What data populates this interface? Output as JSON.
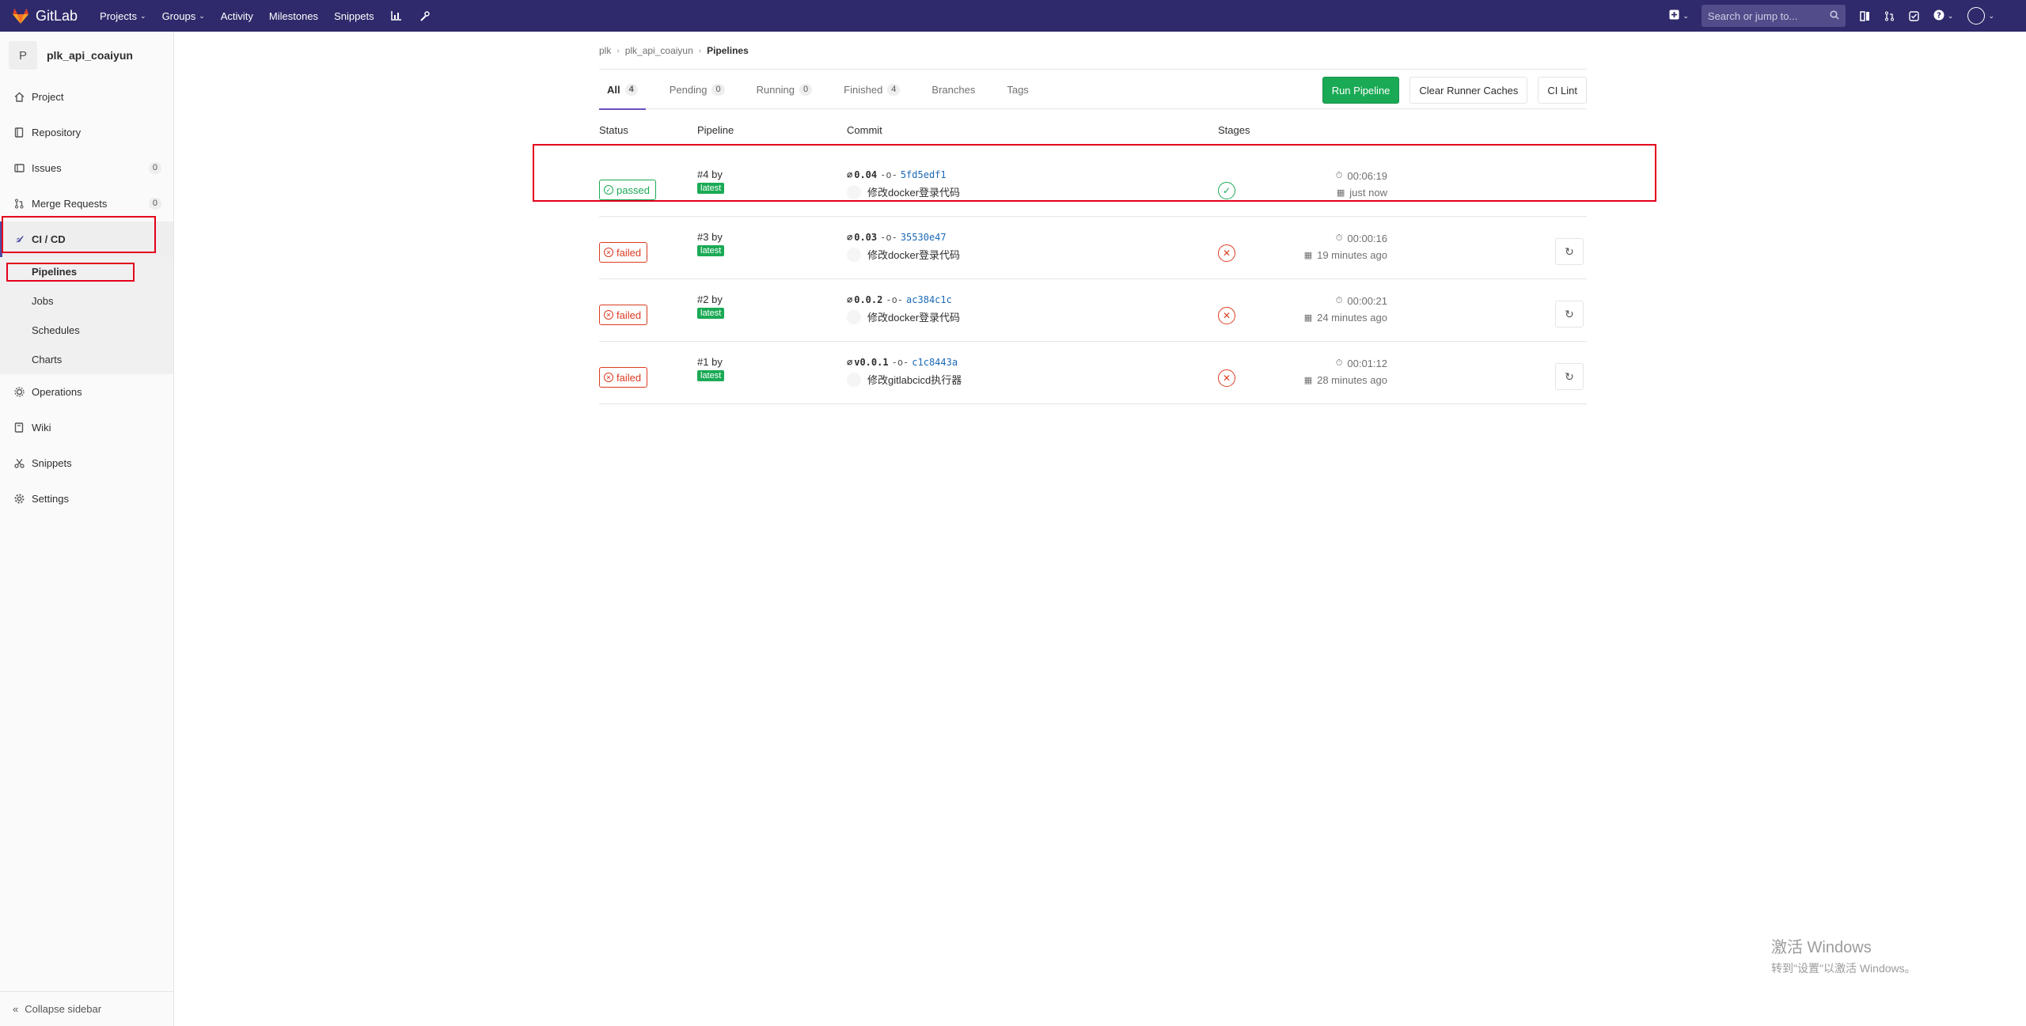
{
  "navbar": {
    "brand": "GitLab",
    "links": [
      {
        "label": "Projects",
        "dropdown": true
      },
      {
        "label": "Groups",
        "dropdown": true
      },
      {
        "label": "Activity",
        "dropdown": false
      },
      {
        "label": "Milestones",
        "dropdown": false
      },
      {
        "label": "Snippets",
        "dropdown": false
      }
    ],
    "search_placeholder": "Search or jump to...",
    "color": "#2f2a6b"
  },
  "sidebar": {
    "project_avatar_letter": "P",
    "project_name": "plk_api_coaiyun",
    "items": [
      {
        "label": "Project",
        "icon": "home-icon"
      },
      {
        "label": "Repository",
        "icon": "book-icon"
      },
      {
        "label": "Issues",
        "icon": "issues-icon",
        "count": "0"
      },
      {
        "label": "Merge Requests",
        "icon": "merge-request-icon",
        "count": "0"
      },
      {
        "label": "CI / CD",
        "icon": "rocket-icon"
      }
    ],
    "sub_items": [
      "Pipelines",
      "Jobs",
      "Schedules",
      "Charts"
    ],
    "items_after": [
      {
        "label": "Operations",
        "icon": "cloud-gear-icon"
      },
      {
        "label": "Wiki",
        "icon": "wiki-book-icon"
      },
      {
        "label": "Snippets",
        "icon": "scissors-icon"
      },
      {
        "label": "Settings",
        "icon": "gear-icon"
      }
    ],
    "collapse_label": "Collapse sidebar"
  },
  "breadcrumb": [
    "plk",
    "plk_api_coaiyun",
    "Pipelines"
  ],
  "tabs": [
    {
      "label": "All",
      "count": "4"
    },
    {
      "label": "Pending",
      "count": "0"
    },
    {
      "label": "Running",
      "count": "0"
    },
    {
      "label": "Finished",
      "count": "4"
    },
    {
      "label": "Branches",
      "count": null
    },
    {
      "label": "Tags",
      "count": null
    }
  ],
  "actions": {
    "run_pipeline": "Run Pipeline",
    "clear_caches": "Clear Runner Caches",
    "ci_lint": "CI Lint"
  },
  "table": {
    "headers": [
      "Status",
      "Pipeline",
      "Commit",
      "Stages"
    ],
    "rows": [
      {
        "status": "passed",
        "id": "#4",
        "by": "by",
        "tag": "latest",
        "ref": "0.04",
        "sha": "5fd5edf1",
        "message": "修改docker登录代码",
        "duration": "00:06:19",
        "finished": "just now"
      },
      {
        "status": "failed",
        "id": "#3",
        "by": "by",
        "tag": "latest",
        "ref": "0.03",
        "sha": "35530e47",
        "message": "修改docker登录代码",
        "duration": "00:00:16",
        "finished": "19 minutes ago"
      },
      {
        "status": "failed",
        "id": "#2",
        "by": "by",
        "tag": "latest",
        "ref": "0.0.2",
        "sha": "ac384c1c",
        "message": "修改docker登录代码",
        "duration": "00:00:21",
        "finished": "24 minutes ago"
      },
      {
        "status": "failed",
        "id": "#1",
        "by": "by",
        "tag": "latest",
        "ref": "v0.0.1",
        "sha": "c1c8443a",
        "message": "修改gitlabcicd执行器",
        "duration": "00:01:12",
        "finished": "28 minutes ago"
      }
    ]
  },
  "watermark": {
    "line1": "激活 Windows",
    "line2": "转到\"设置\"以激活 Windows。"
  },
  "colors": {
    "success": "#1aaa55",
    "danger": "#db3b21",
    "highlight": "#e3001b"
  }
}
